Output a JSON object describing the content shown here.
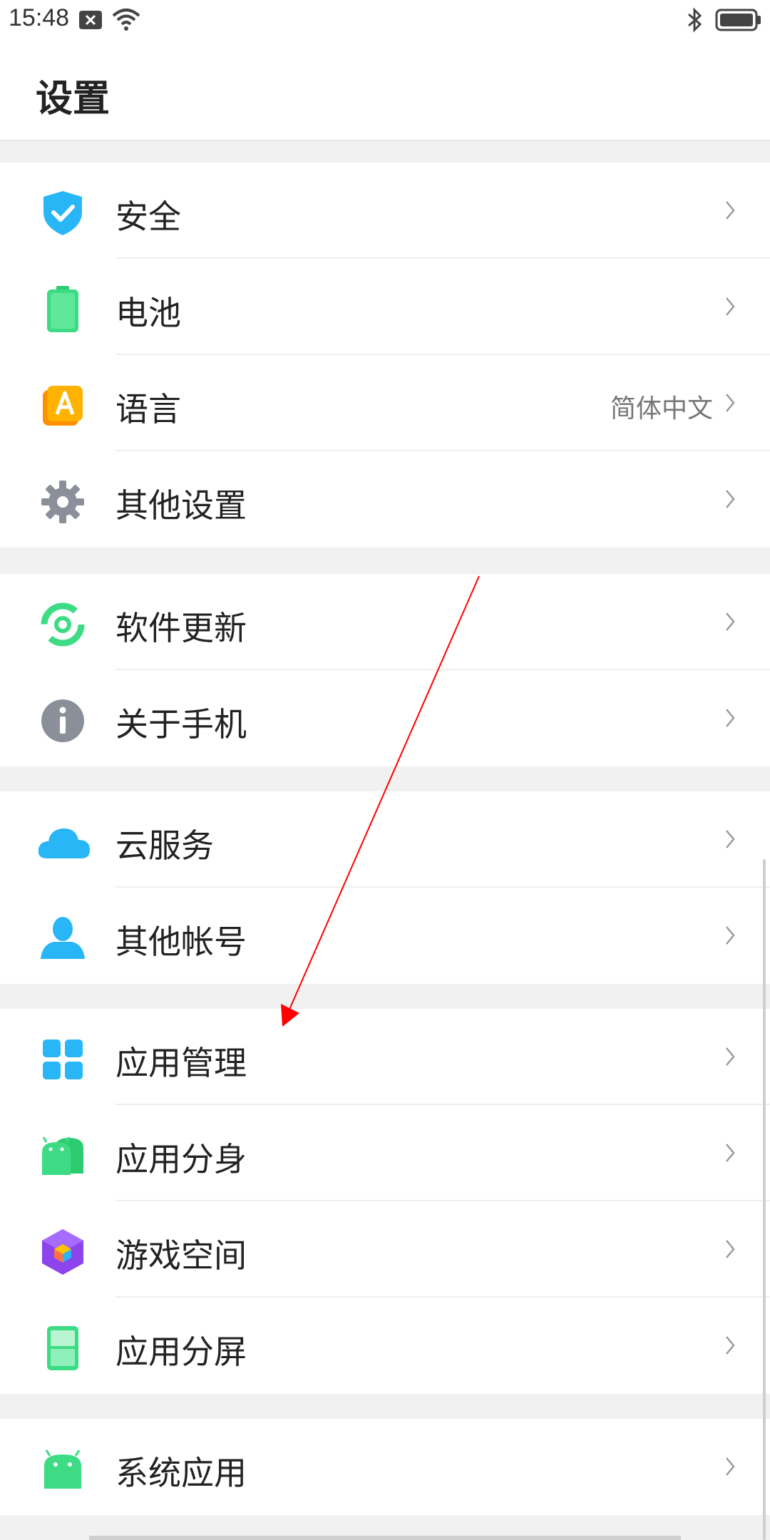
{
  "status": {
    "time": "15:48"
  },
  "header": {
    "title": "设置"
  },
  "groups": [
    {
      "rows": [
        {
          "label": "安全",
          "value": ""
        },
        {
          "label": "电池",
          "value": ""
        },
        {
          "label": "语言",
          "value": "简体中文"
        },
        {
          "label": "其他设置",
          "value": ""
        }
      ]
    },
    {
      "rows": [
        {
          "label": "软件更新",
          "value": ""
        },
        {
          "label": "关于手机",
          "value": ""
        }
      ]
    },
    {
      "rows": [
        {
          "label": "云服务",
          "value": ""
        },
        {
          "label": "其他帐号",
          "value": ""
        }
      ]
    },
    {
      "rows": [
        {
          "label": "应用管理",
          "value": ""
        },
        {
          "label": "应用分身",
          "value": ""
        },
        {
          "label": "游戏空间",
          "value": ""
        },
        {
          "label": "应用分屏",
          "value": ""
        }
      ]
    },
    {
      "rows": [
        {
          "label": "系统应用",
          "value": ""
        }
      ]
    }
  ],
  "icons": [
    "shield-check-icon",
    "battery-icon",
    "language-icon",
    "gear-icon",
    "update-icon",
    "info-icon",
    "cloud-icon",
    "person-icon",
    "app-grid-icon",
    "android-clone-icon",
    "game-cube-icon",
    "split-screen-icon",
    "android-icon"
  ],
  "colors": {
    "accent_blue": "#29b6f6",
    "accent_green": "#3ddc84",
    "annotation": "#ff0000"
  }
}
